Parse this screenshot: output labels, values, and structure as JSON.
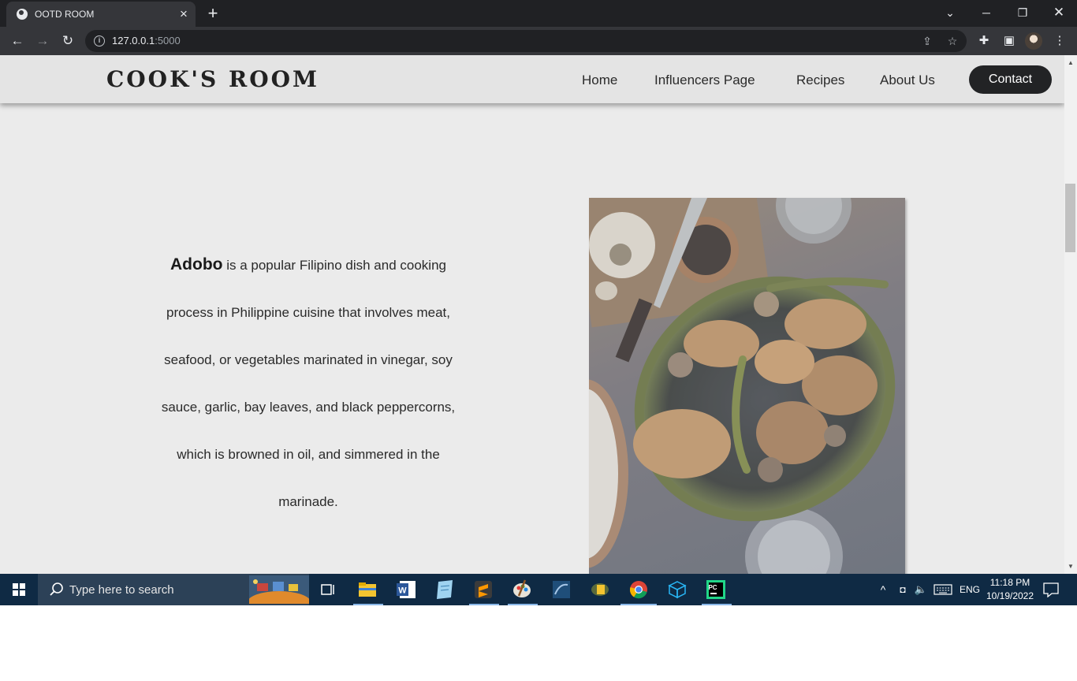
{
  "browser": {
    "tab_title": "OOTD ROOM",
    "url_host": "127.0.0.1",
    "url_port": ":5000"
  },
  "site": {
    "brand": "COOK'S ROOM",
    "nav": [
      "Home",
      "Influencers Page",
      "Recipes",
      "About Us"
    ],
    "contact": "Contact"
  },
  "content": {
    "term": "Adobo",
    "description": " is a popular Filipino dish and cooking process in Philippine cuisine that involves meat, seafood, or vegetables marinated in vinegar, soy sauce, garlic, bay leaves, and black peppercorns, which is browned in oil, and simmered in the marinade.",
    "image_subject": "adobo-dish"
  },
  "taskbar": {
    "search_placeholder": "Type here to search",
    "language": "ENG",
    "time": "11:18 PM",
    "date": "10/19/2022"
  },
  "colors": {
    "page_bg": "#ebebeb",
    "header_bg": "#e4e4e4",
    "contact_bg": "#222325",
    "taskbar_bg": "#0f2a44"
  }
}
